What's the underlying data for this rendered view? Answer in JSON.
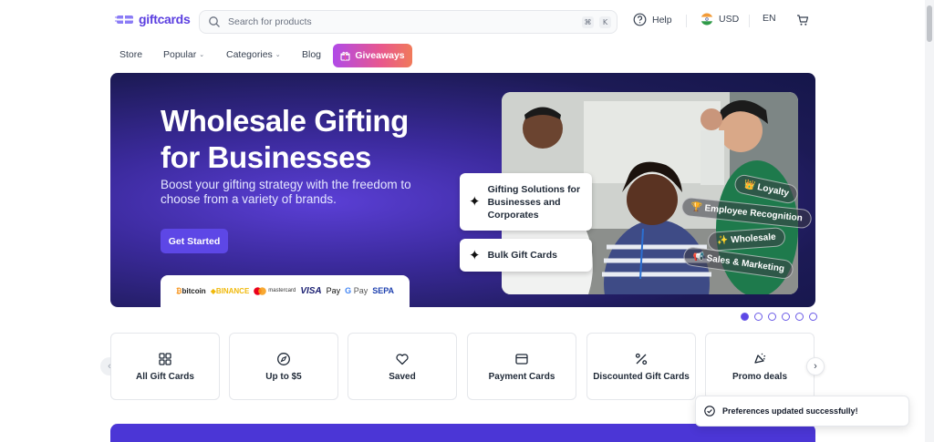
{
  "header": {
    "logo_text": "giftcards",
    "search_placeholder": "Search for products",
    "search_shortcut": [
      "⌘",
      "K"
    ],
    "help_label": "Help",
    "currency_label": "USD",
    "language_label": "EN"
  },
  "nav": {
    "items": [
      {
        "label": "Store",
        "dropdown": false
      },
      {
        "label": "Popular",
        "dropdown": true
      },
      {
        "label": "Categories",
        "dropdown": true
      },
      {
        "label": "Blog",
        "dropdown": false
      }
    ],
    "giveaways_label": "Giveaways"
  },
  "hero": {
    "title": "Wholesale Gifting for Businesses",
    "subtitle": "Boost your gifting strategy with the freedom to choose from a variety of brands.",
    "cta_label": "Get Started",
    "payment_methods": [
      "bitcoin",
      "BINANCE",
      "mastercard",
      "VISA",
      "Pay",
      "Pay",
      "SEPA"
    ],
    "solution_cards": [
      "Gifting Solutions for Businesses and Corporates",
      "Bulk Gift Cards"
    ],
    "tags": [
      "Loyalty",
      "Employee Recognition",
      "Wholesale",
      "Sales & Marketing"
    ],
    "slide_count": 6,
    "active_slide": 1
  },
  "categories": [
    {
      "label": "All Gift Cards",
      "icon": "grid-icon"
    },
    {
      "label": "Up to $5",
      "icon": "compass-icon"
    },
    {
      "label": "Saved",
      "icon": "heart-icon"
    },
    {
      "label": "Payment Cards",
      "icon": "wallet-icon"
    },
    {
      "label": "Discounted Gift Cards",
      "icon": "percent-icon"
    },
    {
      "label": "Promo deals",
      "icon": "promo-icon"
    }
  ],
  "toast": {
    "message": "Preferences updated successfully!"
  },
  "colors": {
    "brand": "#5b3fe0",
    "hero_bg": "#1c1a55",
    "cta": "#5d47e6",
    "giveaways_gradient_start": "#b04ae8",
    "giveaways_gradient_end": "#f07a5a"
  }
}
